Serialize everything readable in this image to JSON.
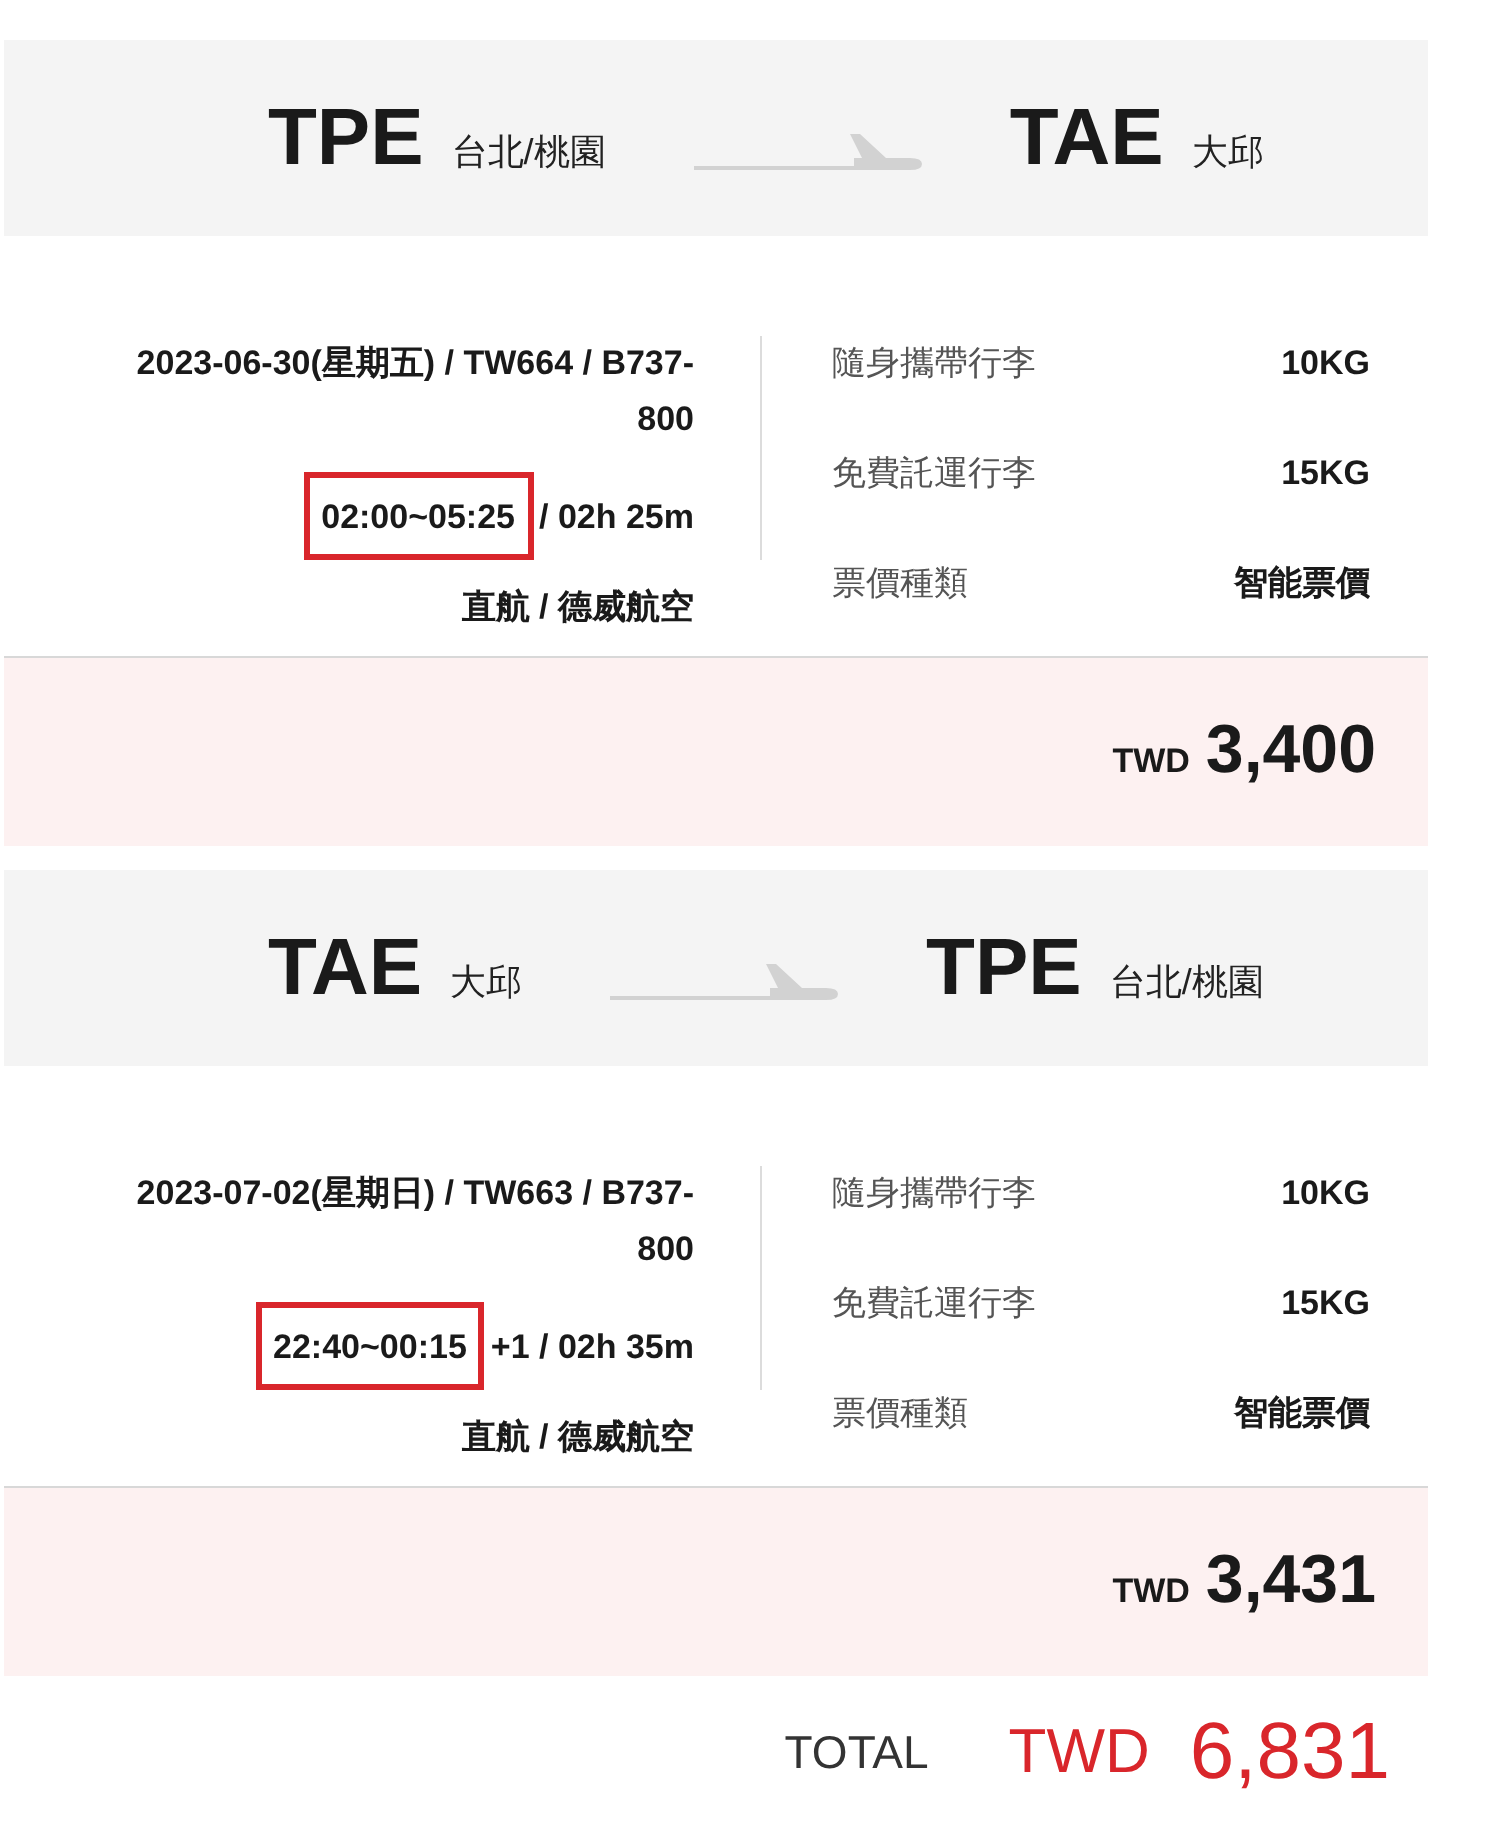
{
  "segments": [
    {
      "origin": {
        "code": "TPE",
        "city": "台北/桃園"
      },
      "destination": {
        "code": "TAE",
        "city": "大邱"
      },
      "flight_info": [
        "2023-06-30(星期五) / TW664 / B737-",
        "800"
      ],
      "time": "02:00~05:25",
      "time_highlighted": true,
      "duration": "/ 02h 25m",
      "route": "直航 / 德威航空",
      "details": [
        {
          "label": "隨身攜帶行李",
          "value": "10KG"
        },
        {
          "label": "免費託運行李",
          "value": "15KG"
        },
        {
          "label": "票價種類",
          "value": "智能票價"
        }
      ],
      "price": {
        "currency": "TWD",
        "amount": "3,400"
      }
    },
    {
      "origin": {
        "code": "TAE",
        "city": "大邱"
      },
      "destination": {
        "code": "TPE",
        "city": "台北/桃園"
      },
      "flight_info": [
        "2023-07-02(星期日) / TW663 / B737-",
        "800"
      ],
      "time": "22:40~00:15",
      "time_highlighted": true,
      "duration": "+1 / 02h 35m",
      "route": "直航 / 德威航空",
      "details": [
        {
          "label": "隨身攜帶行李",
          "value": "10KG"
        },
        {
          "label": "免費託運行李",
          "value": "15KG"
        },
        {
          "label": "票價種類",
          "value": "智能票價"
        }
      ],
      "price": {
        "currency": "TWD",
        "amount": "3,431"
      }
    }
  ],
  "total": {
    "label": "TOTAL",
    "currency": "TWD",
    "amount": "6,831"
  }
}
